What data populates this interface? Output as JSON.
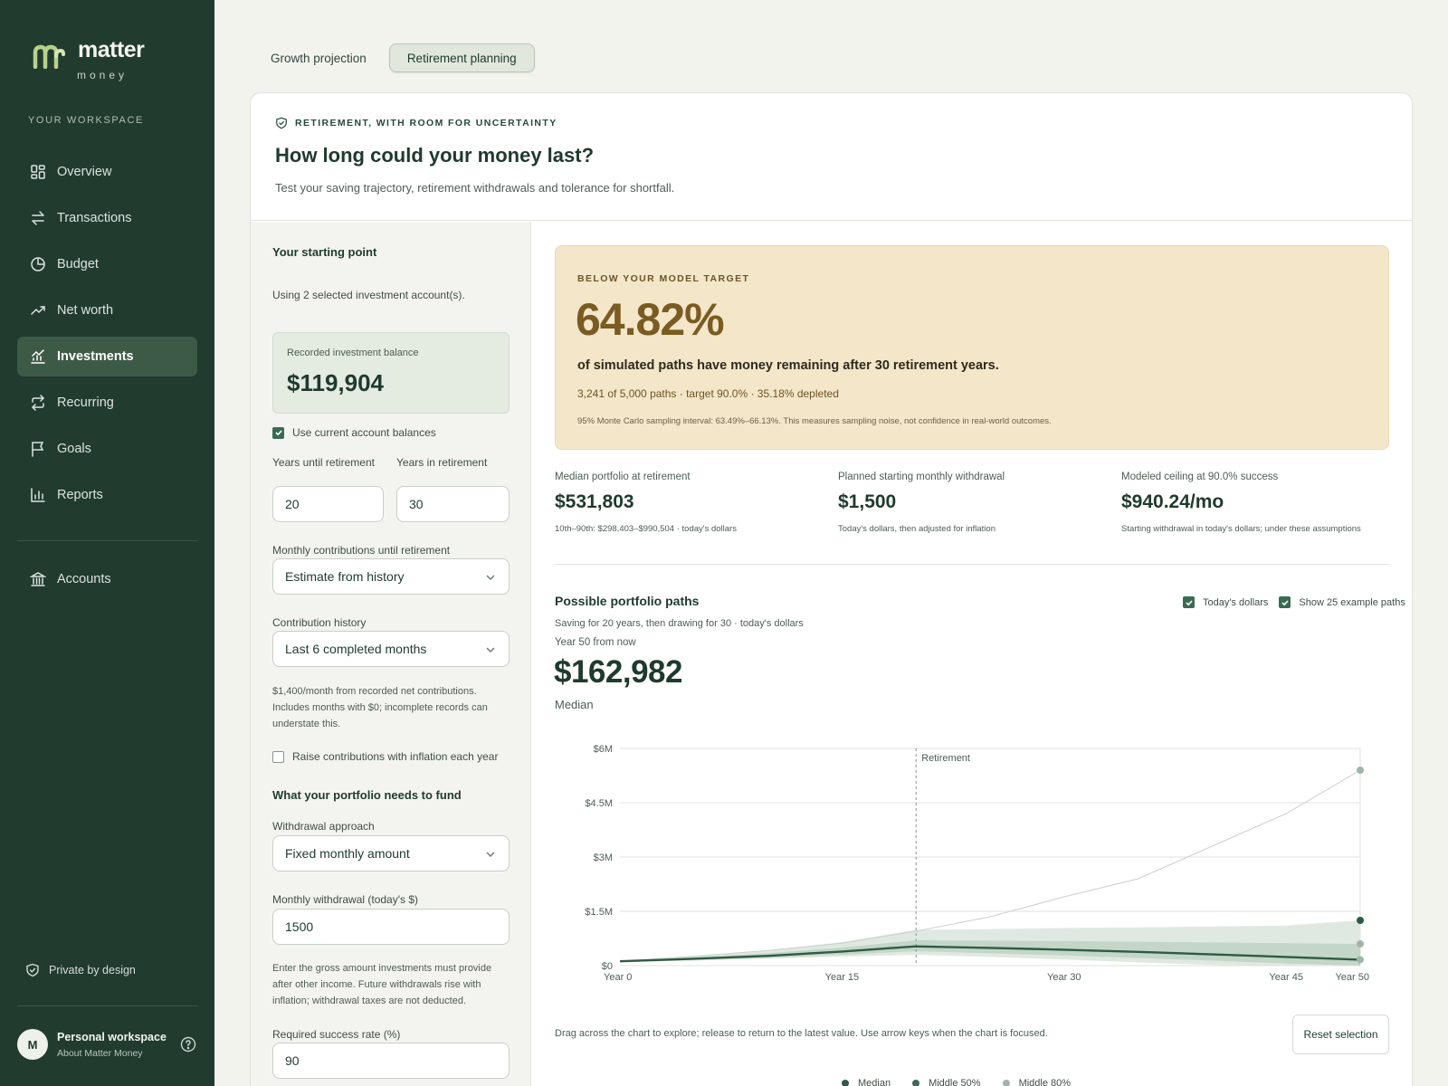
{
  "brand": {
    "name": "matter",
    "sub": "money"
  },
  "sidebar": {
    "workspace_label": "YOUR WORKSPACE",
    "items": [
      {
        "label": "Overview",
        "icon": "grid-icon"
      },
      {
        "label": "Transactions",
        "icon": "arrows-icon"
      },
      {
        "label": "Budget",
        "icon": "pie-icon"
      },
      {
        "label": "Net worth",
        "icon": "trend-icon"
      },
      {
        "label": "Investments",
        "icon": "chart-icon",
        "active": true
      },
      {
        "label": "Recurring",
        "icon": "repeat-icon"
      },
      {
        "label": "Goals",
        "icon": "flag-icon"
      },
      {
        "label": "Reports",
        "icon": "bar-icon"
      }
    ],
    "accounts_label": "Accounts",
    "private_label": "Private by design",
    "user": {
      "initial": "M",
      "name": "Personal workspace",
      "sub": "About Matter Money"
    }
  },
  "tabs": [
    {
      "label": "Growth projection"
    },
    {
      "label": "Retirement planning",
      "active": true
    }
  ],
  "header": {
    "eyebrow": "RETIREMENT, WITH ROOM FOR UNCERTAINTY",
    "title": "How long could your money last?",
    "subtitle": "Test your saving trajectory, retirement withdrawals and tolerance for shortfall."
  },
  "form": {
    "starting_title": "Your starting point",
    "accounts_note": "Using 2 selected investment account(s).",
    "balance_label": "Recorded investment balance",
    "balance_value": "$119,904",
    "use_balances_label": "Use current account balances",
    "years_until_label": "Years until retirement",
    "years_in_label": "Years in retirement",
    "years_until_value": "20",
    "years_in_value": "30",
    "contrib_label": "Monthly contributions until retirement",
    "contrib_value": "Estimate from history",
    "history_label": "Contribution history",
    "history_value": "Last 6 completed months",
    "history_note": "$1,400/month from recorded net contributions. Includes months with $0; incomplete records can understate this.",
    "raise_label": "Raise contributions with inflation each year",
    "fund_title": "What your portfolio needs to fund",
    "approach_label": "Withdrawal approach",
    "approach_value": "Fixed monthly amount",
    "withdrawal_label": "Monthly withdrawal (today's $)",
    "withdrawal_value": "1500",
    "withdrawal_note": "Enter the gross amount investments must provide after other income. Future withdrawals rise with inflation; withdrawal taxes are not deducted.",
    "success_label": "Required success rate (%)",
    "success_value": "90"
  },
  "result": {
    "eyebrow": "BELOW YOUR MODEL TARGET",
    "percent": "64.82%",
    "headline": "of simulated paths have money remaining after 30 retirement years.",
    "detail": "3,241 of 5,000 paths · target 90.0% · 35.18% depleted",
    "note": "95% Monte Carlo sampling interval: 63.49%–66.13%. This measures sampling noise, not confidence in real-world outcomes."
  },
  "stats": [
    {
      "label": "Median portfolio at retirement",
      "value": "$531,803",
      "sub": "10th–90th: $298,403–$990,504 · today's dollars"
    },
    {
      "label": "Planned starting monthly withdrawal",
      "value": "$1,500",
      "sub": "Today's dollars, then adjusted for inflation"
    },
    {
      "label": "Modeled ceiling at 90.0% success",
      "value": "$940.24/mo",
      "sub": "Starting withdrawal in today's dollars; under these assumptions"
    }
  ],
  "chart": {
    "title": "Possible portfolio paths",
    "subtitle": "Saving for 20 years, then drawing for 30 · today's dollars",
    "when": "Year 50 from now",
    "value": "$162,982",
    "value_label": "Median",
    "todays_dollars_label": "Today's dollars",
    "example_paths_label": "Show 25 example paths",
    "drag_note": "Drag across the chart to explore; release to return to the latest value. Use arrow keys when the chart is focused.",
    "reset_label": "Reset selection",
    "colors": {
      "median": "#2f5a44",
      "band50": "#b9cfbf",
      "band80": "#dde7de",
      "paths": "#c9d1cb"
    }
  },
  "chart_data": {
    "type": "area",
    "retirement_label": "Retirement",
    "retirement_year": 20,
    "x_ticks": [
      "Year 0",
      "Year 15",
      "Year 30",
      "Year 45",
      "Year 50"
    ],
    "y_ticks": [
      "$0",
      "$1.5M",
      "$3M",
      "$4.5M",
      "$6M"
    ],
    "ylim": [
      0,
      6000000
    ],
    "x": [
      0,
      5,
      10,
      15,
      20,
      25,
      30,
      35,
      40,
      45,
      50
    ],
    "series": [
      {
        "name": "Median",
        "values": [
          119904,
          190000,
          270000,
          390000,
          531803,
          490000,
          440000,
          380000,
          310000,
          240000,
          162982
        ]
      },
      {
        "name": "Middle 50%",
        "low": [
          110000,
          160000,
          220000,
          300000,
          400000,
          340000,
          280000,
          210000,
          140000,
          60000,
          0
        ],
        "high": [
          130000,
          230000,
          340000,
          500000,
          700000,
          690000,
          680000,
          660000,
          640000,
          620000,
          600000
        ]
      },
      {
        "name": "Middle 80%",
        "low": [
          100000,
          140000,
          190000,
          250000,
          298403,
          240000,
          170000,
          90000,
          20000,
          0,
          0
        ],
        "high": [
          140000,
          260000,
          420000,
          650000,
          990504,
          1010000,
          1040000,
          1060000,
          1080000,
          1110000,
          1250000
        ]
      }
    ],
    "example_high_path": [
      120000,
      260000,
      420000,
      620000,
      950000,
      1350000,
      1900000,
      2400000,
      3300000,
      4200000,
      5400000
    ],
    "legend": [
      "Median",
      "Middle 50%",
      "Middle 80%"
    ]
  }
}
